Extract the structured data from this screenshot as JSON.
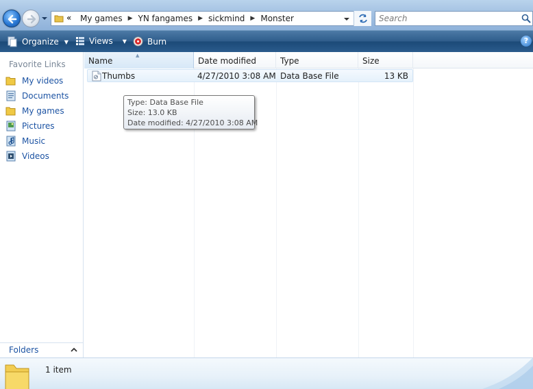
{
  "address_bar": {
    "overflow": "«",
    "breadcrumbs": [
      "My games",
      "YN fangames",
      "sickmind",
      "Monster"
    ]
  },
  "search": {
    "placeholder": "Search"
  },
  "toolbar": {
    "organize_label": "Organize",
    "views_label": "Views",
    "burn_label": "Burn"
  },
  "nav": {
    "favorites_header": "Favorite Links",
    "items": [
      {
        "label": "My videos",
        "icon": "folder-icon"
      },
      {
        "label": "Documents",
        "icon": "documents-icon"
      },
      {
        "label": "My games",
        "icon": "folder-icon"
      },
      {
        "label": "Pictures",
        "icon": "pictures-icon"
      },
      {
        "label": "Music",
        "icon": "music-icon"
      },
      {
        "label": "Videos",
        "icon": "videos-icon"
      }
    ],
    "folders_label": "Folders"
  },
  "columns": {
    "name": "Name",
    "date": "Date modified",
    "type": "Type",
    "size": "Size"
  },
  "files": [
    {
      "name": "Thumbs",
      "date": "4/27/2010 3:08 AM",
      "type": "Data Base File",
      "size": "13 KB"
    }
  ],
  "tooltip": {
    "type": "Type: Data Base File",
    "size": "Size: 13.0 KB",
    "date": "Date modified: 4/27/2010 3:08 AM"
  },
  "details": {
    "item_count": "1 item"
  },
  "colors": {
    "command_bar": "#2a5b8c",
    "link": "#1c53a3",
    "selection": "#e5f1fb"
  }
}
